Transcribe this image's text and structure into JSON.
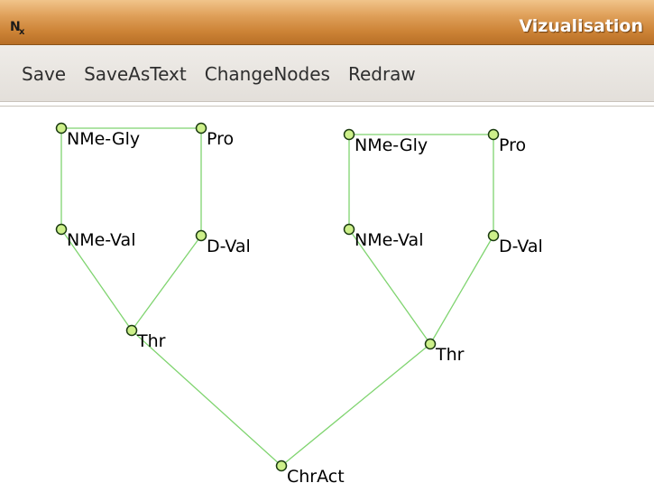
{
  "window": {
    "title": "Vizualisation",
    "icon": "networkx-icon"
  },
  "menu": {
    "items": [
      "Save",
      "SaveAsText",
      "ChangeNodes",
      "Redraw"
    ]
  },
  "graph": {
    "colors": {
      "edge": "#7fd46f",
      "node_fill": "#cdf08a",
      "node_stroke": "#1a3a10"
    },
    "nodes": [
      {
        "id": "a1",
        "label": "NMe-Gly"
      },
      {
        "id": "a2",
        "label": "Pro"
      },
      {
        "id": "a3",
        "label": "NMe-Val"
      },
      {
        "id": "a4",
        "label": "D-Val"
      },
      {
        "id": "a5",
        "label": "Thr"
      },
      {
        "id": "b1",
        "label": "NMe-Gly"
      },
      {
        "id": "b2",
        "label": "Pro"
      },
      {
        "id": "b3",
        "label": "NMe-Val"
      },
      {
        "id": "b4",
        "label": "D-Val"
      },
      {
        "id": "b5",
        "label": "Thr"
      },
      {
        "id": "c",
        "label": "ChrAct"
      }
    ],
    "edges": [
      [
        "a1",
        "a2"
      ],
      [
        "a1",
        "a3"
      ],
      [
        "a2",
        "a4"
      ],
      [
        "a3",
        "a5"
      ],
      [
        "a4",
        "a5"
      ],
      [
        "b1",
        "b2"
      ],
      [
        "b1",
        "b3"
      ],
      [
        "b2",
        "b4"
      ],
      [
        "b3",
        "b5"
      ],
      [
        "b4",
        "b5"
      ],
      [
        "a5",
        "c"
      ],
      [
        "b5",
        "c"
      ]
    ]
  }
}
